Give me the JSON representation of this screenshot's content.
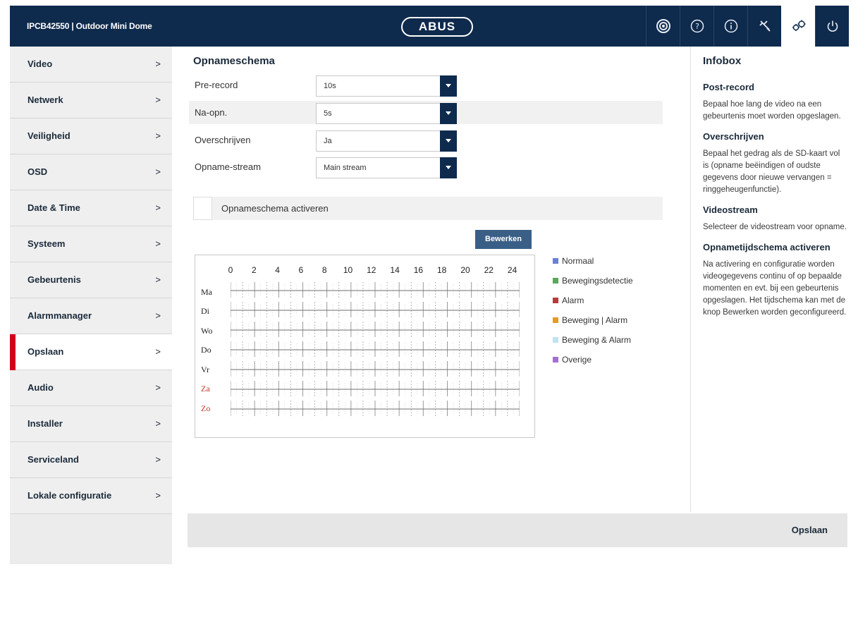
{
  "header": {
    "title": "IPCB42550  |  Outdoor Mini Dome",
    "logo_text": "ABUS",
    "icons": [
      "camera-icon",
      "help-icon",
      "info-icon",
      "tools-icon",
      "settings-icon",
      "power-icon"
    ],
    "brand_color": "#0e2a4d"
  },
  "sidebar": {
    "items": [
      {
        "label": "Video",
        "chevron": ">"
      },
      {
        "label": "Netwerk",
        "chevron": ">"
      },
      {
        "label": "Veiligheid",
        "chevron": ">"
      },
      {
        "label": "OSD",
        "chevron": ">"
      },
      {
        "label": "Date & Time",
        "chevron": ">"
      },
      {
        "label": "Systeem",
        "chevron": ">"
      },
      {
        "label": "Gebeurtenis",
        "chevron": ">"
      },
      {
        "label": "Alarmmanager",
        "chevron": ">"
      },
      {
        "label": "Opslaan",
        "chevron": ">"
      },
      {
        "label": "Audio",
        "chevron": ">"
      },
      {
        "label": "Installer",
        "chevron": ">"
      },
      {
        "label": "Serviceland",
        "chevron": ">"
      },
      {
        "label": "Lokale configuratie",
        "chevron": ">"
      }
    ],
    "active_index": 8,
    "active_color": "#d0021b"
  },
  "main": {
    "title": "Opnameschema",
    "fields": [
      {
        "label": "Pre-record",
        "value": "10s"
      },
      {
        "label": "Na-opn.",
        "value": "5s"
      },
      {
        "label": "Overschrijven",
        "value": "Ja"
      },
      {
        "label": "Opname-stream",
        "value": "Main stream"
      }
    ],
    "activate_label": "Opnameschema activeren",
    "activate_checked": false,
    "edit_button": "Bewerken",
    "schedule": {
      "hours": [
        "0",
        "2",
        "4",
        "6",
        "8",
        "10",
        "12",
        "14",
        "16",
        "18",
        "20",
        "22",
        "24"
      ],
      "days": [
        "Ma",
        "Di",
        "Wo",
        "Do",
        "Vr",
        "Za",
        "Zo"
      ]
    },
    "legend": [
      {
        "label": "Normaal",
        "color": "#6a7fd6"
      },
      {
        "label": "Bewegingsdetectie",
        "color": "#5aa65a"
      },
      {
        "label": "Alarm",
        "color": "#b83a3a"
      },
      {
        "label": "Beweging | Alarm",
        "color": "#e89a1c"
      },
      {
        "label": "Beweging & Alarm",
        "color": "#bfe3ef"
      },
      {
        "label": "Overige",
        "color": "#a070d8"
      }
    ]
  },
  "infobox": {
    "title": "Infobox",
    "sections": [
      {
        "heading": "Post-record",
        "text": "Bepaal hoe lang de video na een gebeurtenis moet worden opgeslagen."
      },
      {
        "heading": "Overschrijven",
        "text": "Bepaal het gedrag als de SD-kaart vol is (opname beëindigen of oudste gegevens door nieuwe vervangen = ringgeheugenfunctie)."
      },
      {
        "heading": "Videostream",
        "text": "Selecteer de videostream voor opname."
      },
      {
        "heading": "Opnametijdschema activeren",
        "text": "Na activering en configuratie worden videogegevens continu of op bepaalde momenten en evt. bij een gebeurtenis opgeslagen. Het tijdschema kan met de knop Bewerken worden geconfigureerd."
      }
    ]
  },
  "footer": {
    "save_label": "Opslaan"
  }
}
